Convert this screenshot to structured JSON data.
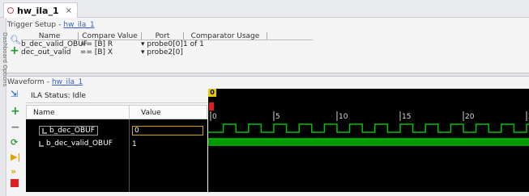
{
  "tab": {
    "title": "hw_ila_1",
    "close": "×"
  },
  "side_panel": {
    "label": "Dashboard Options"
  },
  "trigger_setup": {
    "title": "Trigger Setup",
    "sep": "-",
    "link": "hw_ila_1",
    "columns": [
      "Name",
      "Compare Value",
      "Port",
      "Comparator Usage"
    ],
    "rows": [
      {
        "name": "b_dec_valid_OBUF",
        "op": "==",
        "radix": "[B]",
        "value": "R",
        "port": "probe0[0]",
        "usage": "1 of 1"
      },
      {
        "name": "dec_out_valid",
        "op": "==",
        "radix": "[B]",
        "value": "X",
        "port": "probe2[0]",
        "usage": ""
      }
    ]
  },
  "waveform": {
    "title": "Waveform",
    "sep": "-",
    "link": "hw_ila_1",
    "status": "ILA Status: Idle",
    "columns": {
      "name": "Name",
      "value": "Value"
    },
    "signals": [
      {
        "name": "b_dec_OBUF",
        "value": "0"
      },
      {
        "name": "b_dec_valid_OBUF",
        "value": "1"
      }
    ],
    "trigger_marker": "0",
    "ticks": [
      "0",
      "5",
      "10",
      "15",
      "20",
      "25"
    ],
    "colors": {
      "wave": "#00c000",
      "background": "#000000",
      "marker": "#e8c800"
    }
  }
}
